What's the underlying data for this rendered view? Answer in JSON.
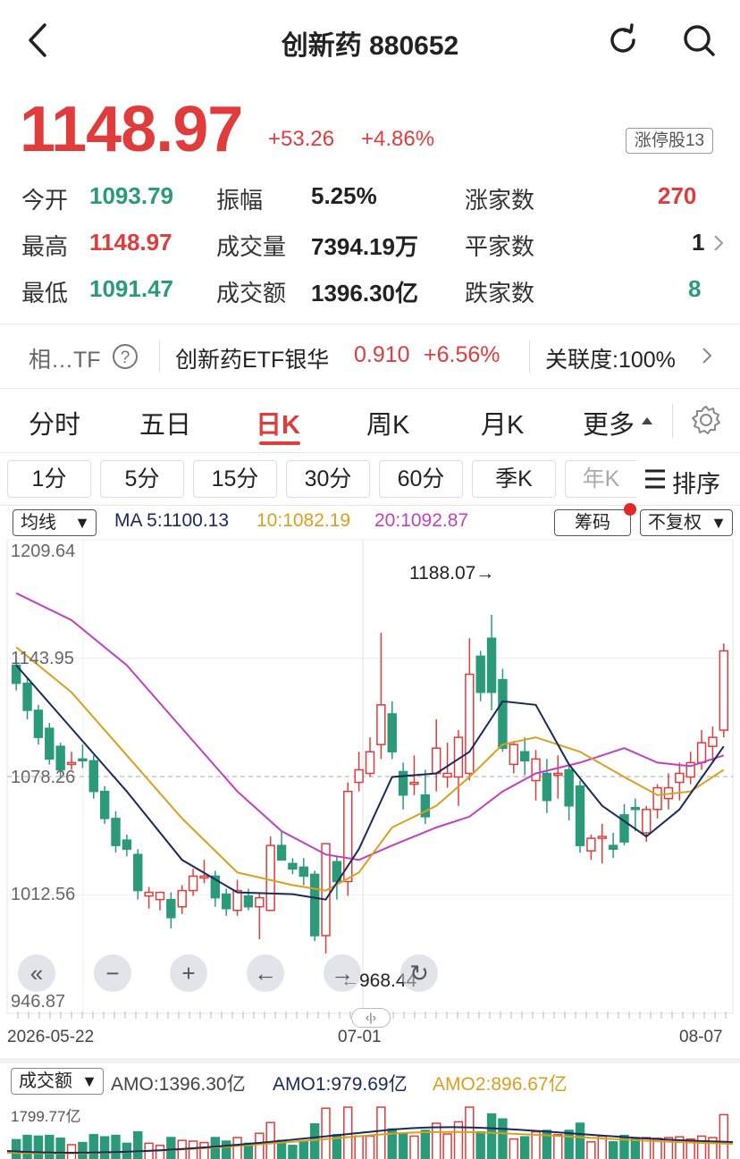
{
  "header": {
    "title": "创新药 880652"
  },
  "quote": {
    "price": "1148.97",
    "change": "+53.26",
    "change_pct": "+4.86%",
    "limit_up_badge": "涨停股13"
  },
  "stats": {
    "open_label": "今开",
    "open": "1093.79",
    "high_label": "最高",
    "high": "1148.97",
    "low_label": "最低",
    "low": "1091.47",
    "amp_label": "振幅",
    "amp": "5.25%",
    "vol_label": "成交量",
    "vol": "7394.19万",
    "amount_label": "成交额",
    "amount": "1396.30亿",
    "up_label": "涨家数",
    "up": "270",
    "flat_label": "平家数",
    "flat": "1",
    "down_label": "跌家数",
    "down": "8"
  },
  "related": {
    "prefix": "相…TF",
    "etf_name": "创新药ETF银华",
    "etf_price": "0.910",
    "etf_change": "+6.56%",
    "correlation": "关联度:100%"
  },
  "period_tabs": [
    "分时",
    "五日",
    "日K",
    "周K",
    "月K",
    "更多"
  ],
  "active_tab": "日K",
  "minute_buttons": [
    "1分",
    "5分",
    "15分",
    "30分",
    "60分",
    "季K",
    "年K"
  ],
  "sort_label": "排序",
  "ma_bar": {
    "selector": "均线",
    "ma5": "MA 5:1100.13",
    "ma10": "10:1082.19",
    "ma20": "20:1092.87",
    "chips_btn": "筹码",
    "adjust_btn": "不复权"
  },
  "colors": {
    "up": "#e03c3c",
    "down": "#2a9a78",
    "ma5": "#1a2a5a",
    "ma10": "#d9a020",
    "ma20": "#c040c0"
  },
  "chart_data": {
    "type": "candlestick",
    "y_ticks": [
      "1209.64",
      "1143.95",
      "1078.26",
      "1012.56",
      "946.87"
    ],
    "ylim": [
      946.87,
      1209.64
    ],
    "x_labels": [
      "2026-05-22",
      "07-01",
      "08-07"
    ],
    "high_annotation": "1188.07→",
    "low_annotation": "←968.44",
    "reference_price": 1078.26,
    "candles": [
      [
        1140,
        1130,
        1143,
        1126
      ],
      [
        1130,
        1115,
        1133,
        1110
      ],
      [
        1115,
        1100,
        1118,
        1096
      ],
      [
        1105,
        1088,
        1108,
        1085
      ],
      [
        1095,
        1082,
        1097,
        1078
      ],
      [
        1085,
        1086,
        1092,
        1082
      ],
      [
        1088,
        1087,
        1096,
        1083
      ],
      [
        1087,
        1070,
        1090,
        1066
      ],
      [
        1070,
        1055,
        1073,
        1052
      ],
      [
        1055,
        1040,
        1059,
        1036
      ],
      [
        1043,
        1038,
        1046,
        1034
      ],
      [
        1035,
        1015,
        1038,
        1010
      ],
      [
        1012,
        1014,
        1017,
        1005
      ],
      [
        1010,
        1014,
        1013,
        1004
      ],
      [
        1010,
        1000,
        1014,
        994
      ],
      [
        1006,
        1015,
        1018,
        1002
      ],
      [
        1015,
        1023,
        1027,
        1012
      ],
      [
        1022,
        1023,
        1032,
        1019
      ],
      [
        1023,
        1011,
        1026,
        1006
      ],
      [
        1013,
        1005,
        1016,
        1001
      ],
      [
        1004,
        1015,
        1021,
        1001
      ],
      [
        1012,
        1006,
        1016,
        1004
      ],
      [
        1006,
        1011,
        1014,
        988
      ],
      [
        1004,
        1040,
        1045,
        1004
      ],
      [
        1040,
        1032,
        1048,
        1032
      ],
      [
        1030,
        1027,
        1033,
        1024
      ],
      [
        1028,
        1023,
        1033,
        1018
      ],
      [
        1024,
        990,
        1026,
        987
      ],
      [
        990,
        1041,
        1041,
        980
      ],
      [
        1031,
        1020,
        1034,
        1010
      ],
      [
        1020,
        1070,
        1075,
        1012
      ],
      [
        1075,
        1082,
        1092,
        1070
      ],
      [
        1080,
        1092,
        1100,
        1078
      ],
      [
        1096,
        1118,
        1158,
        1088
      ],
      [
        1113,
        1092,
        1120,
        1088
      ],
      [
        1081,
        1068,
        1086,
        1060
      ],
      [
        1074,
        1075,
        1090,
        1068
      ],
      [
        1068,
        1056,
        1082,
        1052
      ],
      [
        1080,
        1094,
        1110,
        1070
      ],
      [
        1078,
        1080,
        1097,
        1072
      ],
      [
        1078,
        1100,
        1104,
        1062
      ],
      [
        1080,
        1135,
        1155,
        1076
      ],
      [
        1145,
        1125,
        1148,
        1120
      ],
      [
        1155,
        1125,
        1168,
        1115
      ],
      [
        1132,
        1094,
        1138,
        1092
      ],
      [
        1085,
        1096,
        1098,
        1080
      ],
      [
        1092,
        1087,
        1100,
        1079
      ],
      [
        1076,
        1088,
        1093,
        1065
      ],
      [
        1080,
        1065,
        1088,
        1058
      ],
      [
        1079,
        1080,
        1090,
        1066
      ],
      [
        1082,
        1062,
        1084,
        1054
      ],
      [
        1073,
        1040,
        1076,
        1036
      ],
      [
        1037,
        1044,
        1046,
        1032
      ],
      [
        1044,
        1045,
        1052,
        1030
      ],
      [
        1040,
        1038,
        1047,
        1033
      ],
      [
        1057,
        1042,
        1063,
        1040
      ],
      [
        1061,
        1060,
        1066,
        1048
      ],
      [
        1047,
        1060,
        1062,
        1042
      ],
      [
        1060,
        1072,
        1074,
        1055
      ],
      [
        1066,
        1072,
        1080,
        1060
      ],
      [
        1075,
        1080,
        1086,
        1065
      ],
      [
        1078,
        1086,
        1092,
        1074
      ],
      [
        1086,
        1097,
        1104,
        1082
      ],
      [
        1095,
        1100,
        1106,
        1086
      ],
      [
        1104,
        1148,
        1152,
        1100
      ]
    ],
    "ma5_points": [
      [
        0,
        1140
      ],
      [
        5,
        1105
      ],
      [
        10,
        1070
      ],
      [
        15,
        1032
      ],
      [
        20,
        1014
      ],
      [
        25,
        1013
      ],
      [
        28,
        1010
      ],
      [
        31,
        1038
      ],
      [
        34,
        1078
      ],
      [
        38,
        1080
      ],
      [
        41,
        1092
      ],
      [
        44,
        1120
      ],
      [
        47,
        1118
      ],
      [
        50,
        1085
      ],
      [
        53,
        1062
      ],
      [
        57,
        1045
      ],
      [
        60,
        1060
      ],
      [
        64,
        1095
      ]
    ],
    "ma10_points": [
      [
        0,
        1150
      ],
      [
        5,
        1125
      ],
      [
        10,
        1090
      ],
      [
        15,
        1055
      ],
      [
        20,
        1025
      ],
      [
        25,
        1018
      ],
      [
        28,
        1015
      ],
      [
        31,
        1025
      ],
      [
        34,
        1050
      ],
      [
        38,
        1062
      ],
      [
        41,
        1078
      ],
      [
        44,
        1096
      ],
      [
        47,
        1100
      ],
      [
        51,
        1092
      ],
      [
        55,
        1078
      ],
      [
        58,
        1068
      ],
      [
        61,
        1070
      ],
      [
        64,
        1082
      ]
    ],
    "ma20_points": [
      [
        0,
        1180
      ],
      [
        5,
        1165
      ],
      [
        10,
        1140
      ],
      [
        15,
        1105
      ],
      [
        20,
        1070
      ],
      [
        24,
        1048
      ],
      [
        28,
        1035
      ],
      [
        31,
        1032
      ],
      [
        34,
        1040
      ],
      [
        38,
        1050
      ],
      [
        41,
        1056
      ],
      [
        44,
        1070
      ],
      [
        47,
        1080
      ],
      [
        51,
        1086
      ],
      [
        55,
        1094
      ],
      [
        58,
        1086
      ],
      [
        61,
        1084
      ],
      [
        64,
        1090
      ]
    ]
  },
  "volume_bar": {
    "selector": "成交额",
    "amo": "AMO:1396.30亿",
    "amo1": "AMO1:979.69亿",
    "amo2": "AMO2:896.67亿",
    "max": "1799.77亿"
  }
}
